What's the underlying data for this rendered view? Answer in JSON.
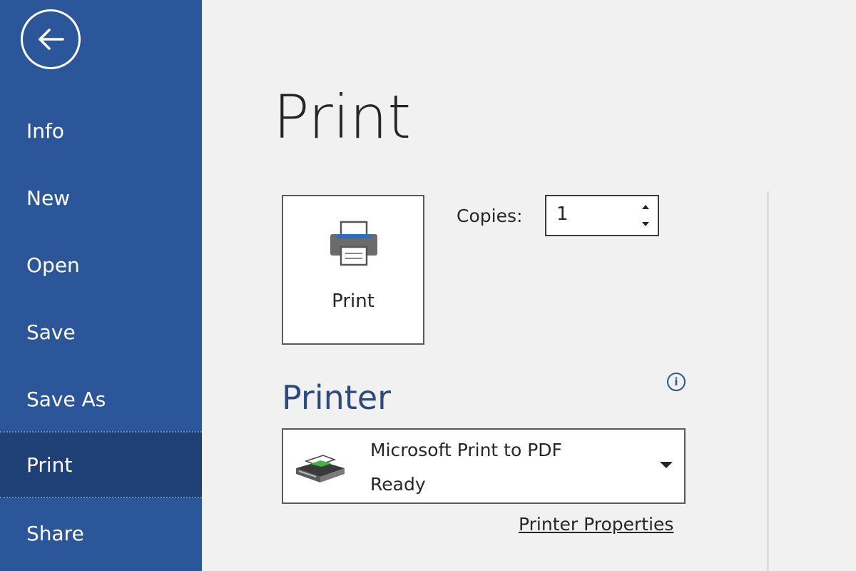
{
  "sidebar": {
    "back_icon": "back-arrow-icon",
    "items": [
      {
        "label": "Info"
      },
      {
        "label": "New"
      },
      {
        "label": "Open"
      },
      {
        "label": "Save"
      },
      {
        "label": "Save As"
      },
      {
        "label": "Print",
        "active": true
      },
      {
        "label": "Share"
      }
    ]
  },
  "main": {
    "title": "Print",
    "print_button": {
      "label": "Print",
      "icon": "printer-icon"
    },
    "copies": {
      "label": "Copies:",
      "value": "1"
    },
    "printer_section": {
      "heading": "Printer",
      "info_icon": "info-icon",
      "selected_printer": {
        "name": "Microsoft Print to PDF",
        "status": "Ready",
        "icon": "printer-device-icon"
      },
      "properties_link": "Printer Properties"
    }
  },
  "colors": {
    "sidebar_bg": "#2b579a",
    "sidebar_active_bg": "#1e4075",
    "main_bg": "#f1f1f1",
    "heading_blue": "#2b4a7e"
  }
}
